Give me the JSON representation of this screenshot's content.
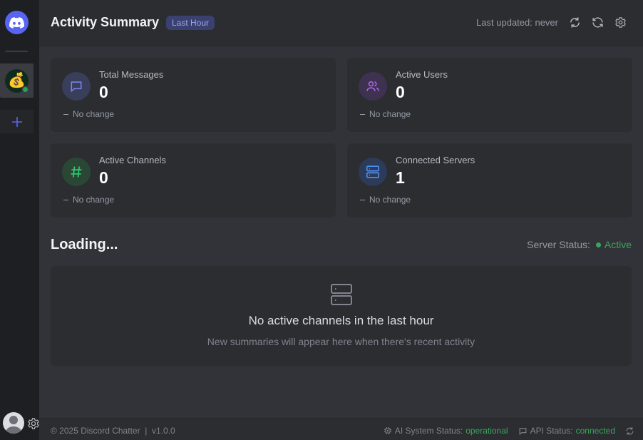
{
  "app": {
    "name": "Discord Chatter",
    "version": "v1.0.0",
    "copyright": "© 2025 Discord Chatter"
  },
  "sidebar": {
    "servers": [
      {
        "icon": "money-bag-emoji",
        "glyph": "💰",
        "status": "online"
      }
    ],
    "add_server_icon": "plus-icon"
  },
  "header": {
    "title": "Activity Summary",
    "range_badge": "Last Hour",
    "last_updated": "Last updated: never"
  },
  "stats": [
    {
      "label": "Total Messages",
      "value": "0",
      "change": "No change",
      "icon": "message-icon",
      "accent": "#5865f2"
    },
    {
      "label": "Active Users",
      "value": "0",
      "change": "No change",
      "icon": "users-icon",
      "accent": "#a855f7"
    },
    {
      "label": "Active Channels",
      "value": "0",
      "change": "No change",
      "icon": "hash-icon",
      "accent": "#22c55e"
    },
    {
      "label": "Connected Servers",
      "value": "1",
      "change": "No change",
      "icon": "server-icon",
      "accent": "#3b82f6"
    }
  ],
  "summaries": {
    "title": "Loading...",
    "server_status_label": "Server Status:",
    "server_status_value": "Active",
    "empty_title": "No active channels in the last hour",
    "empty_subtitle": "New summaries will appear here when there's recent activity"
  },
  "footer": {
    "left": "© 2025 Discord Chatter  |  v1.0.0",
    "ai_label": "AI System Status:",
    "ai_value": "operational",
    "api_label": "API Status:",
    "api_value": "connected"
  },
  "colors": {
    "brand": "#5865f2",
    "ok": "#3ba55c",
    "background": "#313338"
  }
}
